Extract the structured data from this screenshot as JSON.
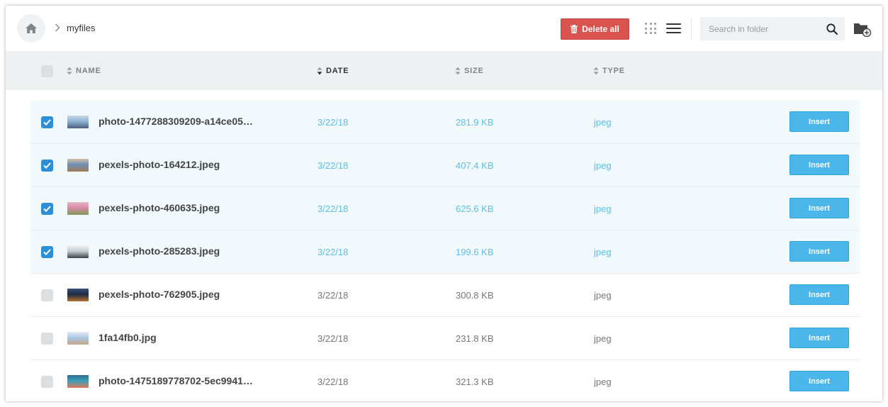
{
  "breadcrumb": {
    "home_icon": "home-icon",
    "separator_icon": "chevron-right-icon",
    "folder": "myfiles"
  },
  "toolbar": {
    "delete_all_label": "Delete all",
    "delete_color": "#d9534f",
    "search_placeholder": "Search in folder",
    "view_mode": "list"
  },
  "columns": {
    "name": "NAME",
    "date": "DATE",
    "size": "SIZE",
    "type": "TYPE",
    "sorted_by": "date"
  },
  "files": [
    {
      "name": "photo-1477288309209-a14ce05…",
      "date": "3/22/18",
      "size": "281.9 KB",
      "type": "jpeg",
      "selected": true,
      "insert_label": "Insert",
      "thumb_colors": [
        "#8fb3d6",
        "#4a5f7a",
        "#c9d6e3"
      ]
    },
    {
      "name": "pexels-photo-164212.jpeg",
      "date": "3/22/18",
      "size": "407.4 KB",
      "type": "jpeg",
      "selected": true,
      "insert_label": "Insert",
      "thumb_colors": [
        "#6c8fb5",
        "#a37a5a",
        "#d7c1a6"
      ]
    },
    {
      "name": "pexels-photo-460635.jpeg",
      "date": "3/22/18",
      "size": "625.6 KB",
      "type": "jpeg",
      "selected": true,
      "insert_label": "Insert",
      "thumb_colors": [
        "#d88aa6",
        "#7d9a5a",
        "#e6b7c4"
      ]
    },
    {
      "name": "pexels-photo-285283.jpeg",
      "date": "3/22/18",
      "size": "199.6 KB",
      "type": "jpeg",
      "selected": true,
      "insert_label": "Insert",
      "thumb_colors": [
        "#c9ced4",
        "#3d4248",
        "#eef0f2"
      ]
    },
    {
      "name": "pexels-photo-762905.jpeg",
      "date": "3/22/18",
      "size": "300.8 KB",
      "type": "jpeg",
      "selected": false,
      "insert_label": "Insert",
      "thumb_colors": [
        "#1d2a44",
        "#b5712b",
        "#3a4f78"
      ]
    },
    {
      "name": "1fa14fb0.jpg",
      "date": "3/22/18",
      "size": "231.8 KB",
      "type": "jpeg",
      "selected": false,
      "insert_label": "Insert",
      "thumb_colors": [
        "#a8c8e6",
        "#c7a98a",
        "#e8ecf0"
      ]
    },
    {
      "name": "photo-1475189778702-5ec9941…",
      "date": "3/22/18",
      "size": "321.3 KB",
      "type": "jpeg",
      "selected": false,
      "insert_label": "Insert",
      "thumb_colors": [
        "#3aa0b8",
        "#e27a5a",
        "#2e6d8a"
      ]
    }
  ],
  "colors": {
    "accent": "#4ab6ea",
    "checkbox_checked": "#2e8fd6",
    "selected_row": "#f2f9fc",
    "selected_text": "#5bbfe6"
  }
}
